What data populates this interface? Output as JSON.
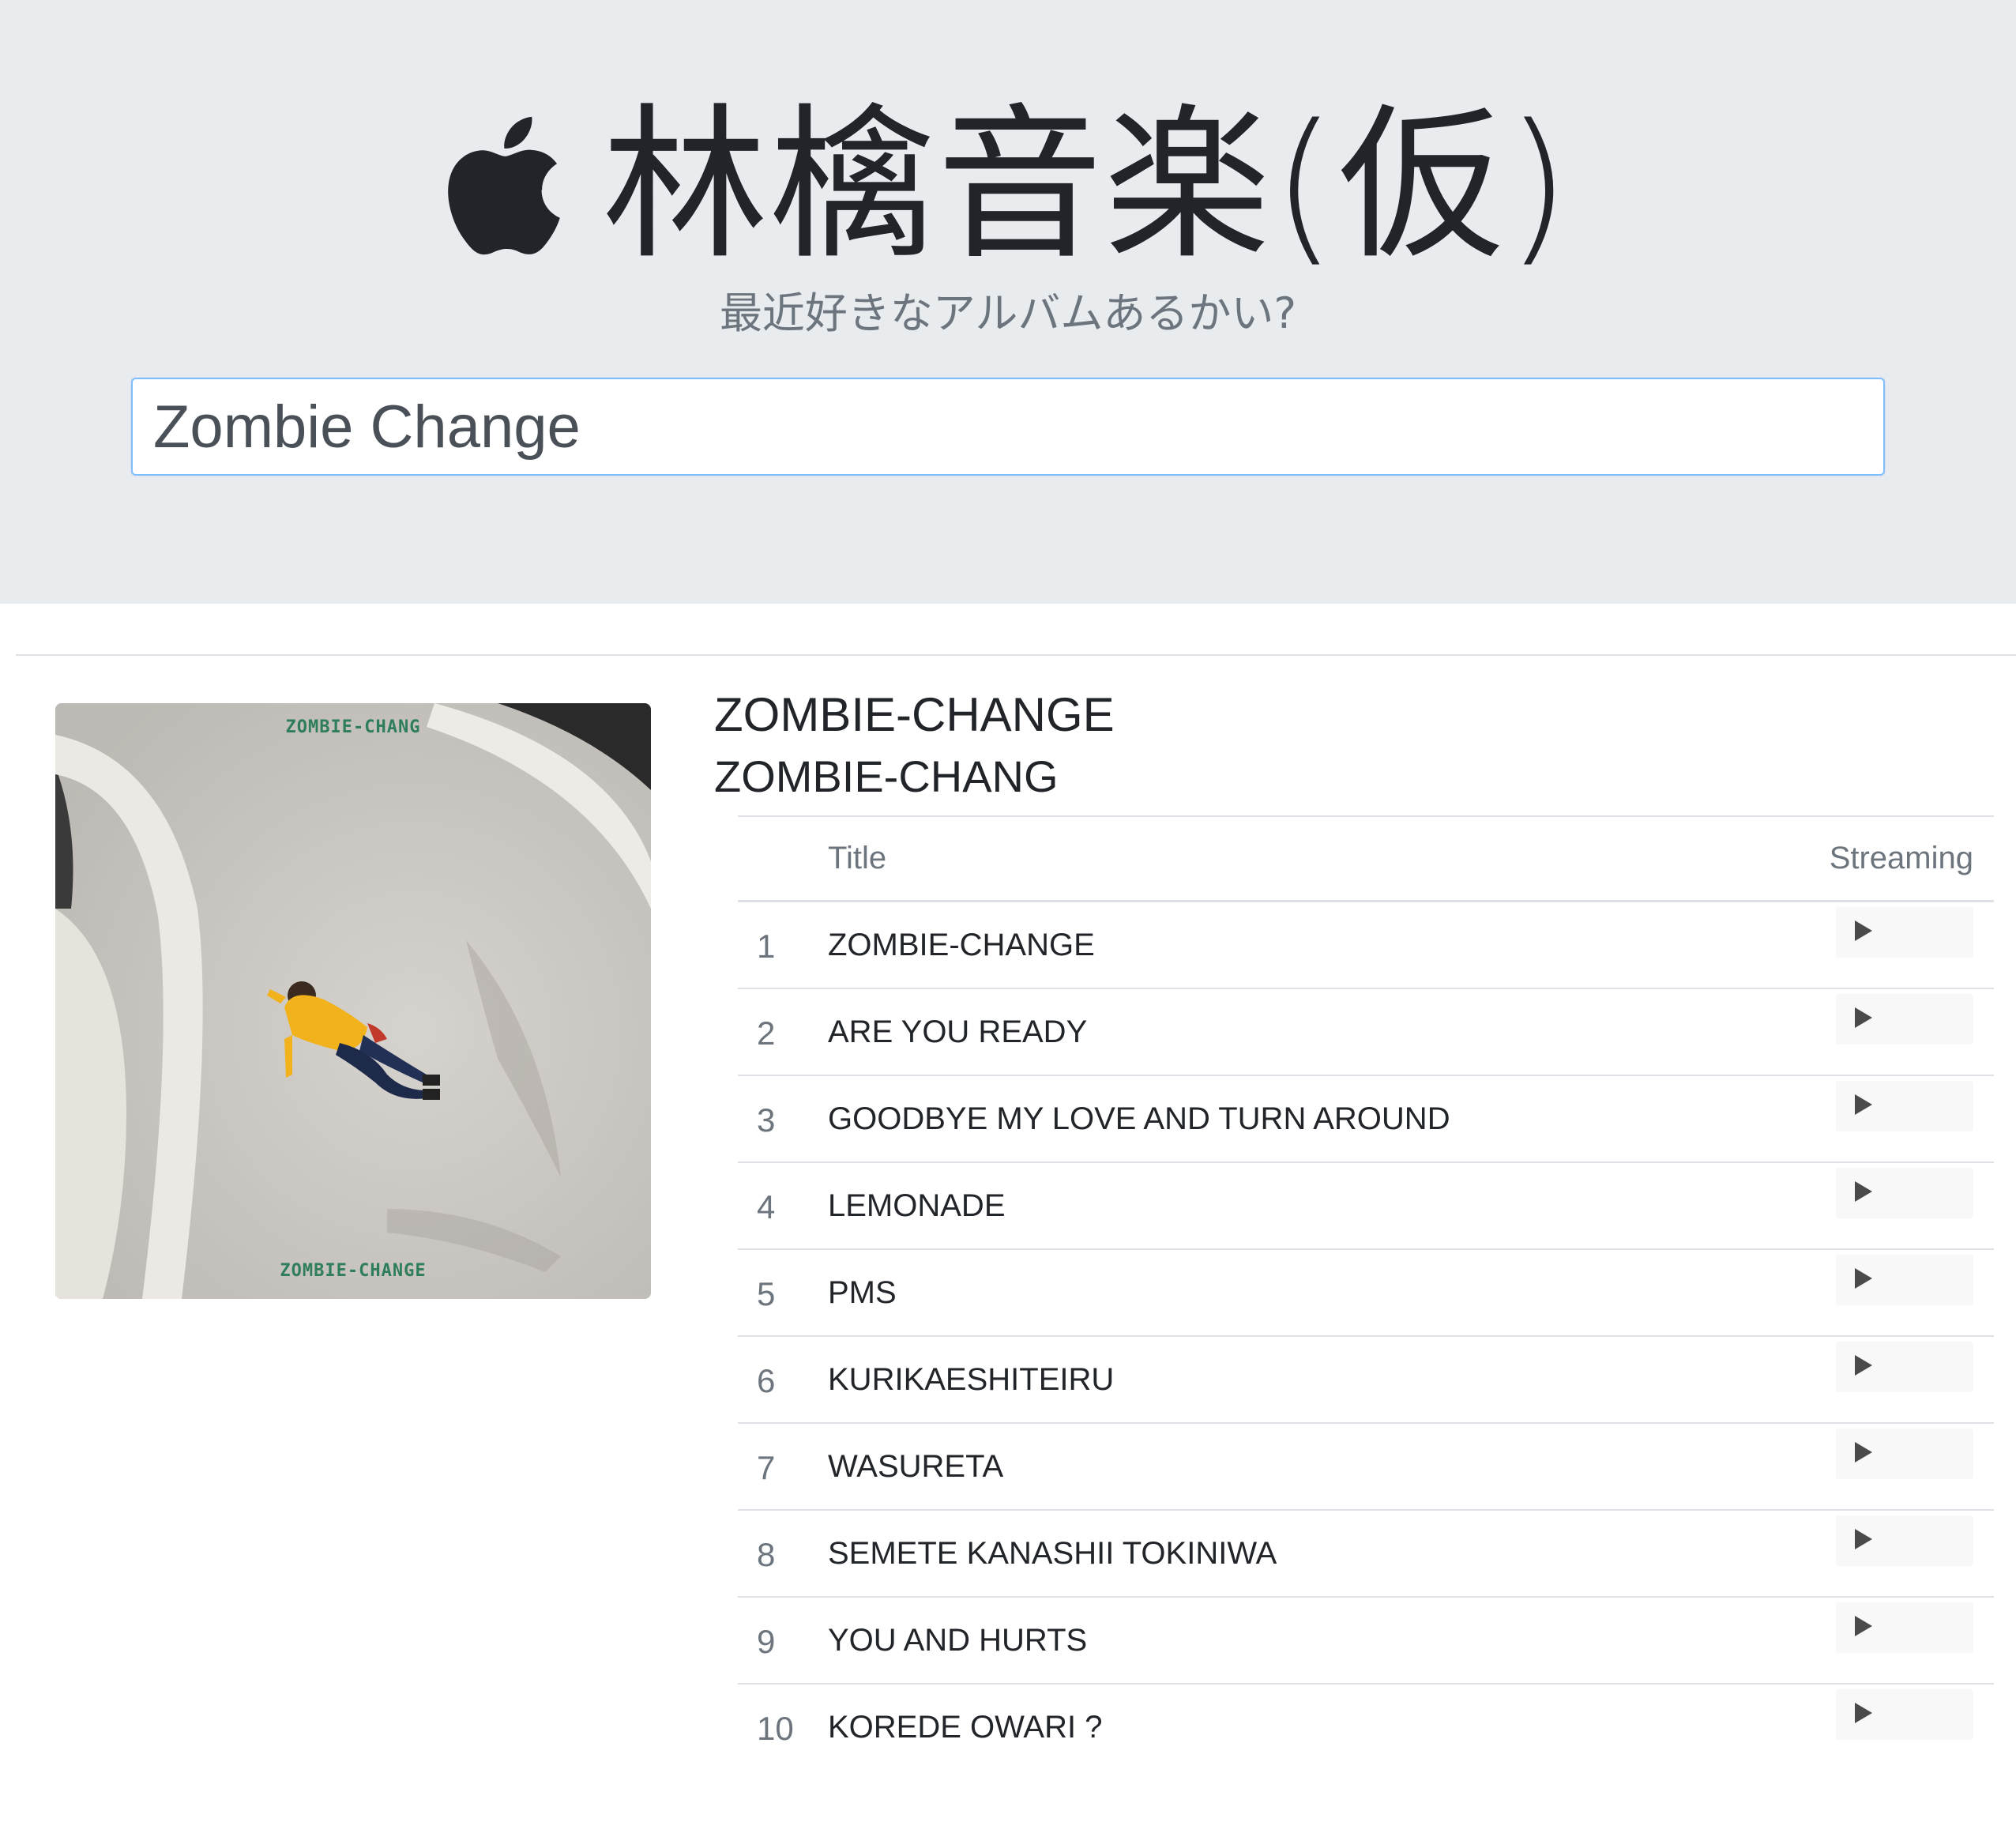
{
  "header": {
    "title": "林檎音楽(仮)",
    "tagline": "最近好きなアルバムあるかい?",
    "logo_icon": "apple-logo-icon"
  },
  "search": {
    "value": "Zombie Change",
    "placeholder": ""
  },
  "album": {
    "title": "ZOMBIE-CHANGE",
    "artist": "ZOMBIE-CHANG",
    "cover_text_top": "ZOMBIE-CHANG",
    "cover_text_bottom": "ZOMBIE-CHANGE"
  },
  "table": {
    "headers": {
      "number": "",
      "title": "Title",
      "streaming": "Streaming"
    },
    "play_icon": "play-icon",
    "tracks": [
      {
        "no": "1",
        "title": "ZOMBIE-CHANGE"
      },
      {
        "no": "2",
        "title": "ARE YOU READY"
      },
      {
        "no": "3",
        "title": "GOODBYE MY LOVE AND TURN AROUND"
      },
      {
        "no": "4",
        "title": "LEMONADE"
      },
      {
        "no": "5",
        "title": "PMS"
      },
      {
        "no": "6",
        "title": "KURIKAESHITEIRU"
      },
      {
        "no": "7",
        "title": "WASURETA"
      },
      {
        "no": "8",
        "title": "SEMETE KANASHII TOKINIWA"
      },
      {
        "no": "9",
        "title": "YOU AND HURTS"
      },
      {
        "no": "10",
        "title": "KOREDE OWARI ?"
      }
    ]
  },
  "colors": {
    "header_bg": "#e9ecef",
    "muted_text": "#6c757d",
    "body_text": "#212529",
    "focus_border": "#80bdff",
    "cover_text": "#2e7d5b"
  }
}
